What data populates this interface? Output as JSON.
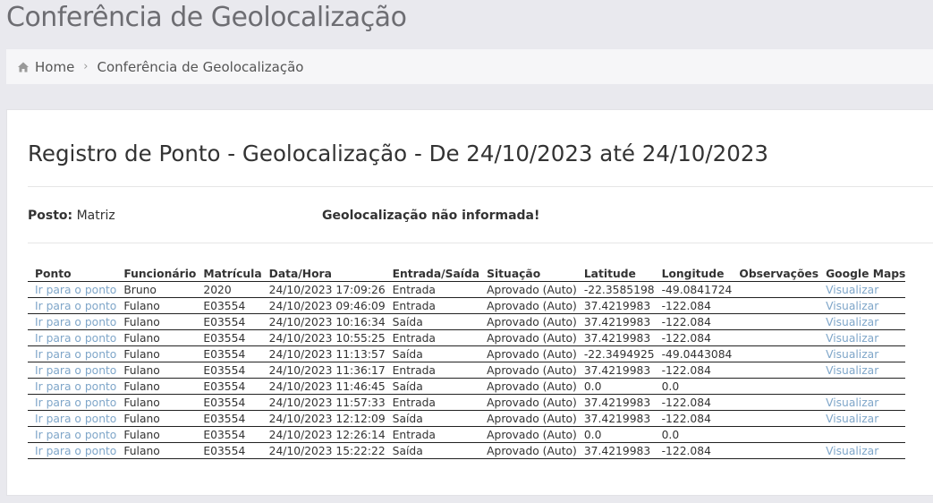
{
  "page": {
    "title": "Conferência de Geolocalização"
  },
  "breadcrumb": {
    "icon": "home-icon",
    "home": "Home",
    "separator": "›",
    "current": "Conferência de Geolocalização"
  },
  "report": {
    "title": "Registro de Ponto - Geolocalização - De 24/10/2023 até 24/10/2023",
    "posto_label": "Posto:",
    "posto_value": "Matriz",
    "geo_message": "Geolocalização não informada!"
  },
  "colors": {
    "link": "#7fa6c9",
    "background": "#e9e9ee"
  },
  "table": {
    "headers": [
      "Ponto",
      "Funcionário",
      "Matrícula",
      "Data/Hora",
      "Entrada/Saída",
      "Situação",
      "Latitude",
      "Longitude",
      "Observações",
      "Google Maps"
    ],
    "rows": [
      {
        "ponto": "Ir para o ponto",
        "funcionario": "Bruno",
        "matricula": "2020",
        "datahora": "24/10/2023 17:09:26",
        "tipo": "Entrada",
        "situacao": "Aprovado (Auto)",
        "latitude": "-22.3585198",
        "longitude": "-49.0841724",
        "observacoes": "",
        "maps": "Visualizar"
      },
      {
        "ponto": "Ir para o ponto",
        "funcionario": "Fulano",
        "matricula": "E03554",
        "datahora": "24/10/2023 09:46:09",
        "tipo": "Entrada",
        "situacao": "Aprovado (Auto)",
        "latitude": "37.4219983",
        "longitude": "-122.084",
        "observacoes": "",
        "maps": "Visualizar"
      },
      {
        "ponto": "Ir para o ponto",
        "funcionario": "Fulano",
        "matricula": "E03554",
        "datahora": "24/10/2023 10:16:34",
        "tipo": "Saída",
        "situacao": "Aprovado (Auto)",
        "latitude": "37.4219983",
        "longitude": "-122.084",
        "observacoes": "",
        "maps": "Visualizar"
      },
      {
        "ponto": "Ir para o ponto",
        "funcionario": "Fulano",
        "matricula": "E03554",
        "datahora": "24/10/2023 10:55:25",
        "tipo": "Entrada",
        "situacao": "Aprovado (Auto)",
        "latitude": "37.4219983",
        "longitude": "-122.084",
        "observacoes": "",
        "maps": "Visualizar"
      },
      {
        "ponto": "Ir para o ponto",
        "funcionario": "Fulano",
        "matricula": "E03554",
        "datahora": "24/10/2023 11:13:57",
        "tipo": "Saída",
        "situacao": "Aprovado (Auto)",
        "latitude": "-22.3494925",
        "longitude": "-49.0443084",
        "observacoes": "",
        "maps": "Visualizar"
      },
      {
        "ponto": "Ir para o ponto",
        "funcionario": "Fulano",
        "matricula": "E03554",
        "datahora": "24/10/2023 11:36:17",
        "tipo": "Entrada",
        "situacao": "Aprovado (Auto)",
        "latitude": "37.4219983",
        "longitude": "-122.084",
        "observacoes": "",
        "maps": "Visualizar"
      },
      {
        "ponto": "Ir para o ponto",
        "funcionario": "Fulano",
        "matricula": "E03554",
        "datahora": "24/10/2023 11:46:45",
        "tipo": "Saída",
        "situacao": "Aprovado (Auto)",
        "latitude": "0.0",
        "longitude": "0.0",
        "observacoes": "",
        "maps": ""
      },
      {
        "ponto": "Ir para o ponto",
        "funcionario": "Fulano",
        "matricula": "E03554",
        "datahora": "24/10/2023 11:57:33",
        "tipo": "Entrada",
        "situacao": "Aprovado (Auto)",
        "latitude": "37.4219983",
        "longitude": "-122.084",
        "observacoes": "",
        "maps": "Visualizar"
      },
      {
        "ponto": "Ir para o ponto",
        "funcionario": "Fulano",
        "matricula": "E03554",
        "datahora": "24/10/2023 12:12:09",
        "tipo": "Saída",
        "situacao": "Aprovado (Auto)",
        "latitude": "37.4219983",
        "longitude": "-122.084",
        "observacoes": "",
        "maps": "Visualizar"
      },
      {
        "ponto": "Ir para o ponto",
        "funcionario": "Fulano",
        "matricula": "E03554",
        "datahora": "24/10/2023 12:26:14",
        "tipo": "Entrada",
        "situacao": "Aprovado (Auto)",
        "latitude": "0.0",
        "longitude": "0.0",
        "observacoes": "",
        "maps": ""
      },
      {
        "ponto": "Ir para o ponto",
        "funcionario": "Fulano",
        "matricula": "E03554",
        "datahora": "24/10/2023 15:22:22",
        "tipo": "Saída",
        "situacao": "Aprovado (Auto)",
        "latitude": "37.4219983",
        "longitude": "-122.084",
        "observacoes": "",
        "maps": "Visualizar"
      }
    ]
  }
}
